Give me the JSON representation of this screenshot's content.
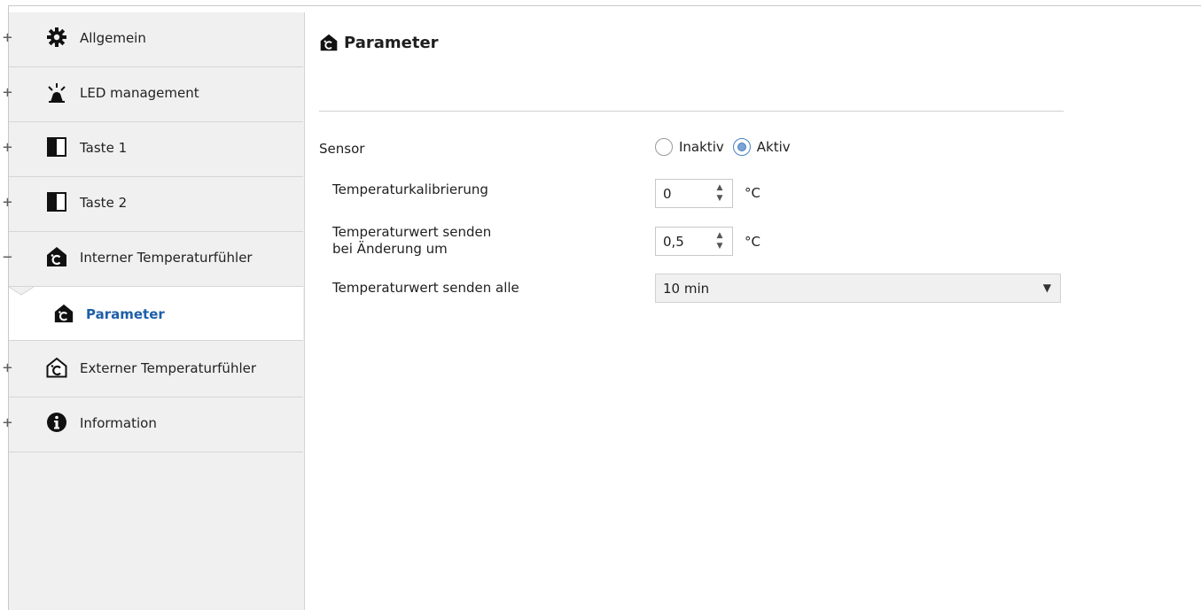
{
  "sidebar": {
    "items": [
      {
        "toggle": "+",
        "label": "Allgemein",
        "icon": "gear-icon"
      },
      {
        "toggle": "+",
        "label": "LED management",
        "icon": "siren-icon"
      },
      {
        "toggle": "+",
        "label": "Taste 1",
        "icon": "button-icon"
      },
      {
        "toggle": "+",
        "label": "Taste 2",
        "icon": "button-icon"
      },
      {
        "toggle": "−",
        "label": "Interner Temperaturfühler",
        "icon": "house-thermometer-icon"
      },
      {
        "toggle": "+",
        "label": "Externer Temperaturfühler",
        "icon": "house-thermometer-outline-icon"
      },
      {
        "toggle": "+",
        "label": "Information",
        "icon": "info-icon"
      }
    ],
    "subitem": {
      "label": "Parameter",
      "icon": "house-thermometer-icon"
    }
  },
  "main": {
    "title": "Parameter",
    "sensor": {
      "label": "Sensor",
      "options": [
        "Inaktiv",
        "Aktiv"
      ],
      "selected": "Aktiv"
    },
    "calibration": {
      "label": "Temperaturkalibrierung",
      "value": "0",
      "unit": "°C"
    },
    "send_on_change": {
      "label_line1": "Temperaturwert senden",
      "label_line2": "bei Änderung um",
      "value": "0,5",
      "unit": "°C"
    },
    "send_every": {
      "label": "Temperaturwert senden alle",
      "value": "10 min"
    }
  },
  "colors": {
    "accent": "#1e5fa8",
    "sidebar_bg": "#f0f0f0",
    "radio_selected": "#7aa3d6"
  }
}
